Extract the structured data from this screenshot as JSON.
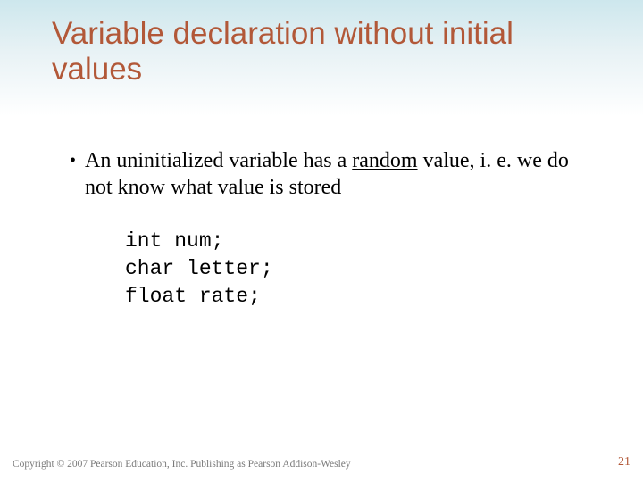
{
  "title": "Variable declaration without initial values",
  "bullet": {
    "pre": "An uninitialized variable has a ",
    "underlined": "random",
    "post": " value, i. e. we do not know what value is stored"
  },
  "code": {
    "line1": "int num;",
    "line2": "char letter;",
    "line3": "float rate;"
  },
  "footer": {
    "copyright": "Copyright © 2007 Pearson Education, Inc. Publishing as Pearson Addison-Wesley",
    "page": "21"
  }
}
